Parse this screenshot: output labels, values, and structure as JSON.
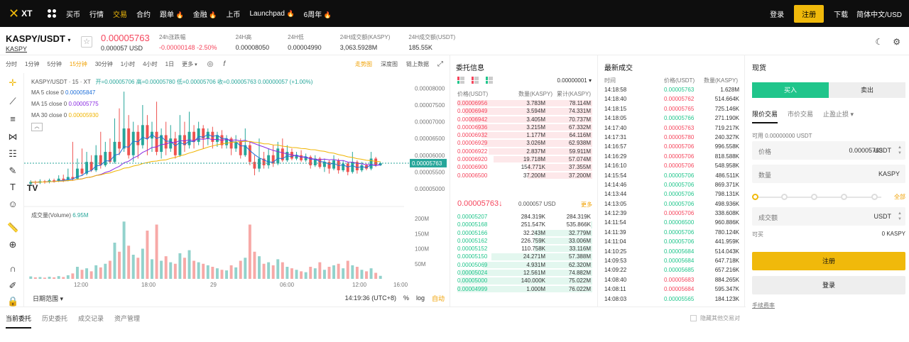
{
  "topnav": {
    "logo_text": "XT",
    "items": [
      {
        "label": "买币",
        "active": false,
        "fire": false
      },
      {
        "label": "行情",
        "active": false,
        "fire": false
      },
      {
        "label": "交易",
        "active": true,
        "fire": false
      },
      {
        "label": "合约",
        "active": false,
        "fire": false
      },
      {
        "label": "跟单",
        "active": false,
        "fire": true
      },
      {
        "label": "金融",
        "active": false,
        "fire": true
      },
      {
        "label": "上币",
        "active": false,
        "fire": false
      },
      {
        "label": "Launchpad",
        "active": false,
        "fire": true
      },
      {
        "label": "6周年",
        "active": false,
        "fire": true
      }
    ],
    "login": "登录",
    "register": "注册",
    "download": "下载",
    "language": "简体中文/USD"
  },
  "ticker": {
    "pair": "KASPY/USDT",
    "pair_sub": "KASPY",
    "price": "0.00005763",
    "price_usd": "0.000057 USD",
    "stats": [
      {
        "label": "24h涨跌幅",
        "value": "-0.00000148 -2.50%",
        "red": true
      },
      {
        "label": "24H高",
        "value": "0.00008050",
        "red": false
      },
      {
        "label": "24H低",
        "value": "0.00004990",
        "red": false
      },
      {
        "label": "24H成交额(KASPY)",
        "value": "3,063.5928M",
        "red": false
      },
      {
        "label": "24H成交额(USDT)",
        "value": "185.55K",
        "red": false
      }
    ]
  },
  "chart": {
    "intervals": [
      "分时",
      "1分钟",
      "5分钟",
      "15分钟",
      "30分钟",
      "1小时",
      "4小时",
      "1日",
      "更多"
    ],
    "active_interval": "15分钟",
    "right_tabs": [
      "走势图",
      "深度图",
      "链上数据"
    ],
    "legend_title": "KASPY/USDT · 15 · XT",
    "ohlc": "开=0.00005706  高=0.00005780  低=0.00005706  收=0.00005763  0.00000057 (+1.00%)",
    "ma5_label": "MA 5 close 0",
    "ma5": "0.00005847",
    "ma15_label": "MA 15 close 0",
    "ma15": "0.00005775",
    "ma30_label": "MA 30 close 0",
    "ma30": "0.00005930",
    "volume_label": "成交量(Volume)",
    "volume_value": "6.95M",
    "current_price_tag": "0.00005763",
    "date_range": "日期范围",
    "time": "14:19:36 (UTC+8)",
    "percent": "%",
    "log": "log",
    "auto": "自动",
    "colors": {
      "up": "#26a69a",
      "down": "#ef5350",
      "ma5": "#1e6fd9",
      "ma15": "#8a2be2",
      "ma30": "#f0b400"
    }
  },
  "chart_data": {
    "type": "candlestick",
    "price_axis": [
      "0.00008000",
      "0.00007500",
      "0.00007000",
      "0.00006500",
      "0.00006000",
      "0.00005500",
      "0.00005000"
    ],
    "volume_axis": [
      "200M",
      "150M",
      "100M",
      "50M"
    ],
    "time_axis": [
      "12:00",
      "18:00",
      "29",
      "06:00",
      "12:00",
      "16:00"
    ],
    "ylim": [
      4.8e-05,
      8.1e-05
    ],
    "candles": [
      {
        "o": 5.15,
        "c": 5.2,
        "h": 5.25,
        "l": 5.1,
        "v": 8
      },
      {
        "o": 5.2,
        "c": 5.18,
        "h": 5.24,
        "l": 5.12,
        "v": 5
      },
      {
        "o": 5.18,
        "c": 5.22,
        "h": 5.28,
        "l": 5.14,
        "v": 6
      },
      {
        "o": 5.22,
        "c": 5.2,
        "h": 5.26,
        "l": 5.15,
        "v": 4
      },
      {
        "o": 5.2,
        "c": 5.25,
        "h": 5.3,
        "l": 5.16,
        "v": 7
      },
      {
        "o": 5.25,
        "c": 5.22,
        "h": 5.3,
        "l": 5.18,
        "v": 5
      },
      {
        "o": 5.22,
        "c": 5.3,
        "h": 5.4,
        "l": 5.2,
        "v": 9
      },
      {
        "o": 5.3,
        "c": 5.26,
        "h": 5.42,
        "l": 5.2,
        "v": 6
      },
      {
        "o": 5.26,
        "c": 5.35,
        "h": 5.6,
        "l": 5.22,
        "v": 12
      },
      {
        "o": 5.35,
        "c": 5.3,
        "h": 6.4,
        "l": 5.25,
        "v": 18
      },
      {
        "o": 5.3,
        "c": 5.6,
        "h": 5.9,
        "l": 5.28,
        "v": 40
      },
      {
        "o": 5.6,
        "c": 5.45,
        "h": 6.2,
        "l": 5.4,
        "v": 30
      },
      {
        "o": 5.45,
        "c": 5.8,
        "h": 6.1,
        "l": 5.4,
        "v": 35
      },
      {
        "o": 5.8,
        "c": 5.55,
        "h": 6.0,
        "l": 5.5,
        "v": 25
      },
      {
        "o": 5.55,
        "c": 6.0,
        "h": 6.3,
        "l": 5.5,
        "v": 45
      },
      {
        "o": 6.0,
        "c": 5.7,
        "h": 6.7,
        "l": 5.6,
        "v": 38
      },
      {
        "o": 5.7,
        "c": 6.1,
        "h": 6.4,
        "l": 5.65,
        "v": 50
      },
      {
        "o": 6.1,
        "c": 5.8,
        "h": 6.5,
        "l": 5.75,
        "v": 60
      },
      {
        "o": 5.8,
        "c": 6.4,
        "h": 7.1,
        "l": 5.75,
        "v": 120
      },
      {
        "o": 6.4,
        "c": 6.2,
        "h": 7.4,
        "l": 6.0,
        "v": 90
      },
      {
        "o": 6.2,
        "c": 6.8,
        "h": 7.9,
        "l": 6.1,
        "v": 190
      },
      {
        "o": 6.8,
        "c": 6.0,
        "h": 7.2,
        "l": 5.9,
        "v": 110
      },
      {
        "o": 6.0,
        "c": 6.7,
        "h": 7.0,
        "l": 5.8,
        "v": 80
      },
      {
        "o": 6.7,
        "c": 6.3,
        "h": 6.9,
        "l": 5.9,
        "v": 70
      },
      {
        "o": 6.3,
        "c": 6.9,
        "h": 7.5,
        "l": 6.2,
        "v": 100
      },
      {
        "o": 6.9,
        "c": 6.5,
        "h": 7.2,
        "l": 6.0,
        "v": 160
      },
      {
        "o": 6.5,
        "c": 6.7,
        "h": 7.0,
        "l": 6.1,
        "v": 65
      },
      {
        "o": 6.7,
        "c": 6.1,
        "h": 7.6,
        "l": 6.0,
        "v": 180
      },
      {
        "o": 6.1,
        "c": 6.6,
        "h": 6.8,
        "l": 5.9,
        "v": 60
      },
      {
        "o": 6.6,
        "c": 6.2,
        "h": 7.0,
        "l": 6.0,
        "v": 75
      },
      {
        "o": 6.2,
        "c": 6.5,
        "h": 6.9,
        "l": 6.1,
        "v": 55
      },
      {
        "o": 6.5,
        "c": 6.0,
        "h": 6.7,
        "l": 5.9,
        "v": 50
      },
      {
        "o": 6.0,
        "c": 6.6,
        "h": 7.2,
        "l": 5.95,
        "v": 85
      },
      {
        "o": 6.6,
        "c": 6.3,
        "h": 7.0,
        "l": 6.1,
        "v": 70
      },
      {
        "o": 6.3,
        "c": 6.7,
        "h": 7.3,
        "l": 6.2,
        "v": 95
      },
      {
        "o": 6.7,
        "c": 6.4,
        "h": 6.9,
        "l": 6.2,
        "v": 60
      },
      {
        "o": 6.4,
        "c": 6.8,
        "h": 7.0,
        "l": 6.3,
        "v": 55
      },
      {
        "o": 6.8,
        "c": 6.5,
        "h": 6.9,
        "l": 6.2,
        "v": 50
      },
      {
        "o": 6.5,
        "c": 6.7,
        "h": 6.8,
        "l": 6.3,
        "v": 45
      },
      {
        "o": 6.7,
        "c": 6.4,
        "h": 6.85,
        "l": 6.2,
        "v": 40
      },
      {
        "o": 6.4,
        "c": 6.6,
        "h": 6.7,
        "l": 6.25,
        "v": 35
      },
      {
        "o": 6.6,
        "c": 6.3,
        "h": 6.75,
        "l": 6.2,
        "v": 30
      },
      {
        "o": 6.3,
        "c": 6.5,
        "h": 6.6,
        "l": 6.2,
        "v": 28
      },
      {
        "o": 6.5,
        "c": 6.2,
        "h": 6.55,
        "l": 6.0,
        "v": 45
      },
      {
        "o": 6.2,
        "c": 6.4,
        "h": 6.6,
        "l": 6.1,
        "v": 38
      },
      {
        "o": 6.4,
        "c": 6.0,
        "h": 6.5,
        "l": 5.9,
        "v": 60
      },
      {
        "o": 6.0,
        "c": 6.3,
        "h": 6.8,
        "l": 5.95,
        "v": 70
      },
      {
        "o": 6.3,
        "c": 5.8,
        "h": 6.4,
        "l": 5.7,
        "v": 180
      },
      {
        "o": 5.8,
        "c": 5.6,
        "h": 6.0,
        "l": 5.4,
        "v": 90
      },
      {
        "o": 5.6,
        "c": 5.9,
        "h": 6.5,
        "l": 5.5,
        "v": 75
      },
      {
        "o": 5.9,
        "c": 5.7,
        "h": 6.1,
        "l": 5.6,
        "v": 50
      },
      {
        "o": 5.7,
        "c": 6.0,
        "h": 6.2,
        "l": 5.6,
        "v": 55
      },
      {
        "o": 6.0,
        "c": 5.75,
        "h": 6.3,
        "l": 5.65,
        "v": 45
      },
      {
        "o": 5.75,
        "c": 6.2,
        "h": 6.4,
        "l": 5.7,
        "v": 65
      },
      {
        "o": 6.2,
        "c": 5.85,
        "h": 6.5,
        "l": 5.8,
        "v": 55
      },
      {
        "o": 5.85,
        "c": 6.1,
        "h": 6.3,
        "l": 5.8,
        "v": 40
      },
      {
        "o": 6.1,
        "c": 5.9,
        "h": 6.2,
        "l": 5.85,
        "v": 35
      },
      {
        "o": 5.9,
        "c": 6.0,
        "h": 6.1,
        "l": 5.85,
        "v": 30
      },
      {
        "o": 6.0,
        "c": 5.85,
        "h": 6.15,
        "l": 5.8,
        "v": 25
      },
      {
        "o": 5.85,
        "c": 5.95,
        "h": 6.05,
        "l": 5.8,
        "v": 22
      },
      {
        "o": 5.95,
        "c": 5.7,
        "h": 6.0,
        "l": 5.6,
        "v": 40
      },
      {
        "o": 5.7,
        "c": 5.9,
        "h": 6.0,
        "l": 5.65,
        "v": 35
      },
      {
        "o": 5.9,
        "c": 5.65,
        "h": 5.95,
        "l": 5.6,
        "v": 55
      },
      {
        "o": 5.65,
        "c": 5.8,
        "h": 5.9,
        "l": 5.5,
        "v": 30
      },
      {
        "o": 5.8,
        "c": 5.6,
        "h": 5.85,
        "l": 5.45,
        "v": 40
      },
      {
        "o": 5.6,
        "c": 5.85,
        "h": 6.0,
        "l": 5.55,
        "v": 45
      },
      {
        "o": 5.85,
        "c": 5.55,
        "h": 5.9,
        "l": 5.45,
        "v": 50
      },
      {
        "o": 5.55,
        "c": 5.75,
        "h": 5.85,
        "l": 5.5,
        "v": 35
      },
      {
        "o": 5.75,
        "c": 5.5,
        "h": 5.8,
        "l": 5.4,
        "v": 60
      },
      {
        "o": 5.5,
        "c": 5.8,
        "h": 6.1,
        "l": 5.45,
        "v": 45
      },
      {
        "o": 5.8,
        "c": 5.55,
        "h": 5.85,
        "l": 5.45,
        "v": 40
      },
      {
        "o": 5.55,
        "c": 5.7,
        "h": 5.8,
        "l": 5.5,
        "v": 30
      },
      {
        "o": 5.7,
        "c": 5.6,
        "h": 5.75,
        "l": 5.55,
        "v": 25
      },
      {
        "o": 5.6,
        "c": 5.9,
        "h": 6.1,
        "l": 5.55,
        "v": 35
      },
      {
        "o": 5.9,
        "c": 5.7,
        "h": 5.95,
        "l": 5.65,
        "v": 20
      },
      {
        "o": 5.7,
        "c": 5.76,
        "h": 5.8,
        "l": 5.68,
        "v": 10
      }
    ],
    "price_unit": 1e-05
  },
  "orderbook": {
    "title": "委托信息",
    "precision": "0.00000001",
    "headers": [
      "价格(USDT)",
      "数量(KASPY)",
      "累计(KASPY)"
    ],
    "asks": [
      {
        "price": "0.00006956",
        "amount": "3.783M",
        "total": "78.114M",
        "depth": 1.0
      },
      {
        "price": "0.00006949",
        "amount": "3.594M",
        "total": "74.331M",
        "depth": 0.95
      },
      {
        "price": "0.00006942",
        "amount": "3.405M",
        "total": "70.737M",
        "depth": 0.91
      },
      {
        "price": "0.00006936",
        "amount": "3.215M",
        "total": "67.332M",
        "depth": 0.86
      },
      {
        "price": "0.00006932",
        "amount": "1.177M",
        "total": "64.116M",
        "depth": 0.82
      },
      {
        "price": "0.00006929",
        "amount": "3.026M",
        "total": "62.938M",
        "depth": 0.81
      },
      {
        "price": "0.00006922",
        "amount": "2.837M",
        "total": "59.911M",
        "depth": 0.77
      },
      {
        "price": "0.00006920",
        "amount": "19.718M",
        "total": "57.074M",
        "depth": 0.73
      },
      {
        "price": "0.00006900",
        "amount": "154.771K",
        "total": "37.355M",
        "depth": 0.48
      },
      {
        "price": "0.00006500",
        "amount": "37.200M",
        "total": "37.200M",
        "depth": 0.48
      }
    ],
    "mid_price": "0.00005763↓",
    "mid_usd": "0.000057 USD",
    "more": "更多",
    "bids": [
      {
        "price": "0.00005207",
        "amount": "284.319K",
        "total": "284.319K",
        "depth": 0.0
      },
      {
        "price": "0.00005168",
        "amount": "251.547K",
        "total": "535.866K",
        "depth": 0.01
      },
      {
        "price": "0.00005166",
        "amount": "32.243M",
        "total": "32.779M",
        "depth": 0.43
      },
      {
        "price": "0.00005162",
        "amount": "226.759K",
        "total": "33.006M",
        "depth": 0.43
      },
      {
        "price": "0.00005152",
        "amount": "110.758K",
        "total": "33.116M",
        "depth": 0.43
      },
      {
        "price": "0.00005150",
        "amount": "24.271M",
        "total": "57.388M",
        "depth": 0.75
      },
      {
        "price": "0.00005069",
        "amount": "4.931M",
        "total": "62.320M",
        "depth": 0.81
      },
      {
        "price": "0.00005024",
        "amount": "12.561M",
        "total": "74.882M",
        "depth": 0.98
      },
      {
        "price": "0.00005000",
        "amount": "140.000K",
        "total": "75.022M",
        "depth": 0.98
      },
      {
        "price": "0.00004999",
        "amount": "1.000M",
        "total": "76.022M",
        "depth": 1.0
      }
    ]
  },
  "trades": {
    "title": "最新成交",
    "headers": [
      "时间",
      "价格(USDT)",
      "数量(KASPY)"
    ],
    "rows": [
      {
        "time": "14:18:58",
        "price": "0.00005763",
        "amount": "1.628M",
        "up": true
      },
      {
        "time": "14:18:40",
        "price": "0.00005762",
        "amount": "514.664K",
        "up": false
      },
      {
        "time": "14:18:15",
        "price": "0.00005765",
        "amount": "725.146K",
        "up": false
      },
      {
        "time": "14:18:05",
        "price": "0.00005766",
        "amount": "271.190K",
        "up": true
      },
      {
        "time": "14:17:40",
        "price": "0.00005763",
        "amount": "719.217K",
        "up": false
      },
      {
        "time": "14:17:31",
        "price": "0.00005780",
        "amount": "240.327K",
        "up": false
      },
      {
        "time": "14:16:57",
        "price": "0.00005706",
        "amount": "996.558K",
        "up": false
      },
      {
        "time": "14:16:29",
        "price": "0.00005706",
        "amount": "818.588K",
        "up": false
      },
      {
        "time": "14:16:10",
        "price": "0.00005706",
        "amount": "548.958K",
        "up": false
      },
      {
        "time": "14:15:54",
        "price": "0.00005706",
        "amount": "486.511K",
        "up": true
      },
      {
        "time": "14:14:46",
        "price": "0.00005706",
        "amount": "869.371K",
        "up": true
      },
      {
        "time": "14:13:44",
        "price": "0.00005706",
        "amount": "798.131K",
        "up": true
      },
      {
        "time": "14:13:05",
        "price": "0.00005706",
        "amount": "498.936K",
        "up": true
      },
      {
        "time": "14:12:39",
        "price": "0.00005706",
        "amount": "338.608K",
        "up": false
      },
      {
        "time": "14:11:54",
        "price": "0.00006500",
        "amount": "960.886K",
        "up": true
      },
      {
        "time": "14:11:39",
        "price": "0.00005706",
        "amount": "780.124K",
        "up": true
      },
      {
        "time": "14:11:04",
        "price": "0.00005706",
        "amount": "441.959K",
        "up": true
      },
      {
        "time": "14:10:25",
        "price": "0.00005684",
        "amount": "514.043K",
        "up": true
      },
      {
        "time": "14:09:53",
        "price": "0.00005684",
        "amount": "647.718K",
        "up": true
      },
      {
        "time": "14:09:22",
        "price": "0.00005685",
        "amount": "657.216K",
        "up": true
      },
      {
        "time": "14:08:40",
        "price": "0.00005683",
        "amount": "884.265K",
        "up": false
      },
      {
        "time": "14:08:11",
        "price": "0.00005684",
        "amount": "595.347K",
        "up": false
      },
      {
        "time": "14:08:03",
        "price": "0.00005565",
        "amount": "184.123K",
        "up": true
      }
    ]
  },
  "spot": {
    "title": "现货",
    "buy": "买入",
    "sell": "卖出",
    "order_tabs": [
      "限价交易",
      "市价交易",
      "止盈止损 ▾"
    ],
    "available": "可用 0.00000000 USDT",
    "price_label": "价格",
    "price_value": "0.00005763",
    "price_unit": "USDT",
    "amount_label": "数量",
    "amount_unit": "KASPY",
    "all": "全部",
    "total_label": "成交额",
    "total_unit": "USDT",
    "can_buy_label": "可买",
    "can_buy_value": "0 KASPY",
    "register_btn": "注册",
    "login_btn": "登录",
    "fee": "手续费率"
  },
  "bottom_tabs": {
    "tabs": [
      "当前委托",
      "历史委托",
      "成交记录",
      "资产管理"
    ],
    "hide_other": "隐藏其他交易对"
  },
  "colors": {
    "accent": "#f0b90b",
    "up": "#20c58b",
    "down": "#f5455c"
  }
}
